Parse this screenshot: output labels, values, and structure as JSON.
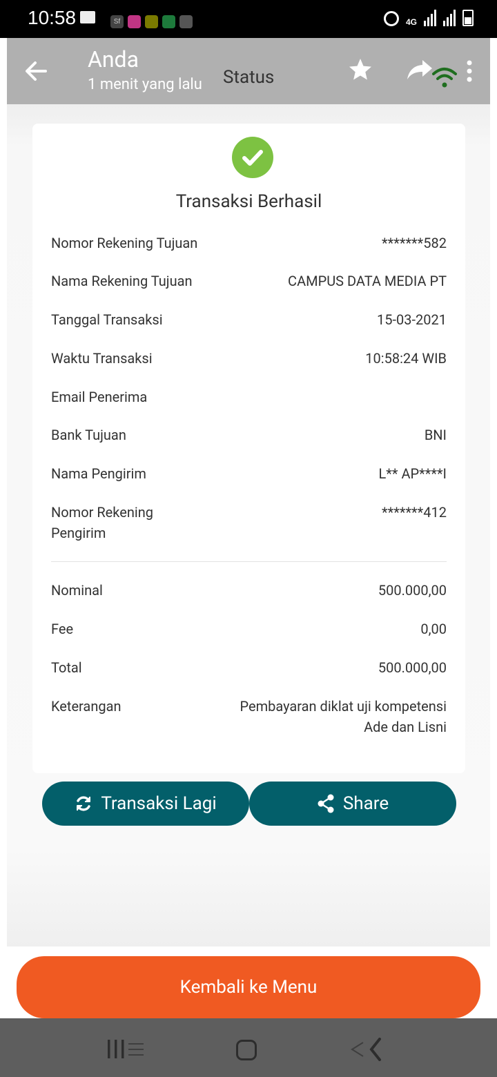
{
  "status_bar": {
    "time": "10:58",
    "network": "4G",
    "app_icons": [
      "sf",
      "instagram",
      "l",
      "whatsapp",
      "app"
    ]
  },
  "header": {
    "title": "Anda",
    "subtitle": "1 menit yang lalu",
    "center_label": "Status",
    "icons": [
      "back-arrow-icon",
      "star-icon",
      "forward-icon",
      "wifi-icon",
      "more-icon"
    ]
  },
  "receipt": {
    "status_title": "Transaksi Berhasil",
    "details": [
      {
        "label": "Nomor Rekening Tujuan",
        "value": "*******582"
      },
      {
        "label": "Nama Rekening Tujuan",
        "value": "CAMPUS DATA MEDIA PT"
      },
      {
        "label": "Tanggal Transaksi",
        "value": "15-03-2021"
      },
      {
        "label": "Waktu Transaksi",
        "value": "10:58:24 WIB"
      },
      {
        "label": "Email Penerima",
        "value": ""
      },
      {
        "label": "Bank Tujuan",
        "value": "BNI"
      },
      {
        "label": "Nama Pengirim",
        "value": "L** AP****I"
      },
      {
        "label": "Nomor Rekening\nPengirim",
        "value": "*******412"
      }
    ],
    "amounts": [
      {
        "label": "Nominal",
        "value": "500.000,00"
      },
      {
        "label": "Fee",
        "value": "0,00"
      },
      {
        "label": "Total",
        "value": "500.000,00"
      },
      {
        "label": "Keterangan",
        "value": "Pembayaran diklat uji kompetensi\nAde dan Lisni"
      }
    ]
  },
  "actions": {
    "again_label": "Transaksi Lagi",
    "share_label": "Share",
    "menu_label": "Kembali ke Menu"
  },
  "colors": {
    "header": "#b0b0b0",
    "success": "#7dc242",
    "action_button": "#035f6a",
    "menu_button": "#f05a22",
    "navbar": "#5e5e5e"
  }
}
